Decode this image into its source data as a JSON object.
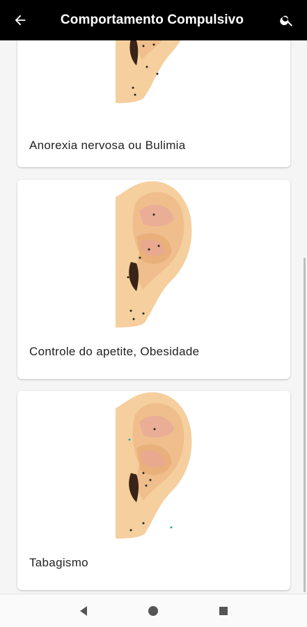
{
  "header": {
    "title": "Comportamento Compulsivo",
    "back_icon": "arrow-back-icon",
    "search_icon": "search-icon"
  },
  "cards": [
    {
      "label": "Anorexia nervosa ou Bulimia",
      "image": "ear-acupuncture-points-image"
    },
    {
      "label": "Controle do apetite, Obesidade",
      "image": "ear-acupuncture-points-image"
    },
    {
      "label": "Tabagismo",
      "image": "ear-acupuncture-points-image"
    }
  ],
  "navbar": {
    "back_icon": "nav-back-triangle-icon",
    "home_icon": "nav-home-circle-icon",
    "recents_icon": "nav-recents-square-icon"
  },
  "colors": {
    "appbar": "#000000",
    "skin": "#f6cf9e",
    "skin_shadow": "#e9b07b",
    "inner_pink": "#e8a59a"
  }
}
